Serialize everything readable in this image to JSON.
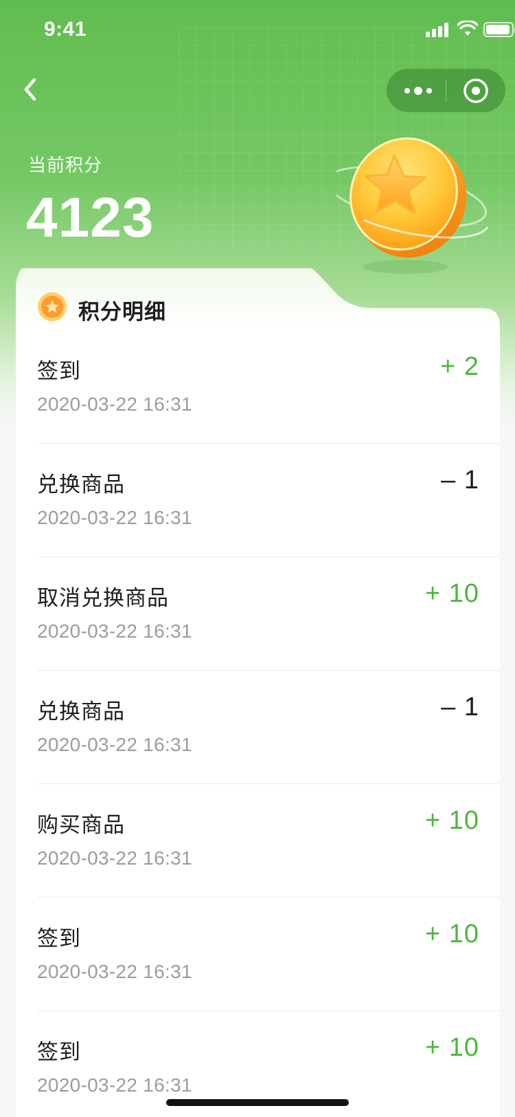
{
  "status_bar": {
    "time": "9:41"
  },
  "header": {
    "points_label": "当前积分",
    "points_value": "4123"
  },
  "card": {
    "title": "积分明细",
    "items": [
      {
        "title": "签到",
        "time": "2020-03-22 16:31",
        "amount": "+ 2",
        "type": "plus"
      },
      {
        "title": "兑换商品",
        "time": "2020-03-22 16:31",
        "amount": "– 1",
        "type": "minus"
      },
      {
        "title": "取消兑换商品",
        "time": "2020-03-22 16:31",
        "amount": "+ 10",
        "type": "plus"
      },
      {
        "title": "兑换商品",
        "time": "2020-03-22 16:31",
        "amount": "– 1",
        "type": "minus"
      },
      {
        "title": "购买商品",
        "time": "2020-03-22 16:31",
        "amount": "+ 10",
        "type": "plus"
      },
      {
        "title": "签到",
        "time": "2020-03-22 16:31",
        "amount": "+ 10",
        "type": "plus"
      },
      {
        "title": "签到",
        "time": "2020-03-22 16:31",
        "amount": "+ 10",
        "type": "plus"
      }
    ]
  },
  "colors": {
    "brand_green": "#61bd4f",
    "positive": "#4fb43f",
    "negative": "#1e1e1e",
    "muted": "#9c9c9c"
  },
  "icons": [
    "back-arrow-icon",
    "more-dots-icon",
    "close-target-icon",
    "coin-star-icon",
    "signal-icon",
    "wifi-icon",
    "battery-icon"
  ]
}
